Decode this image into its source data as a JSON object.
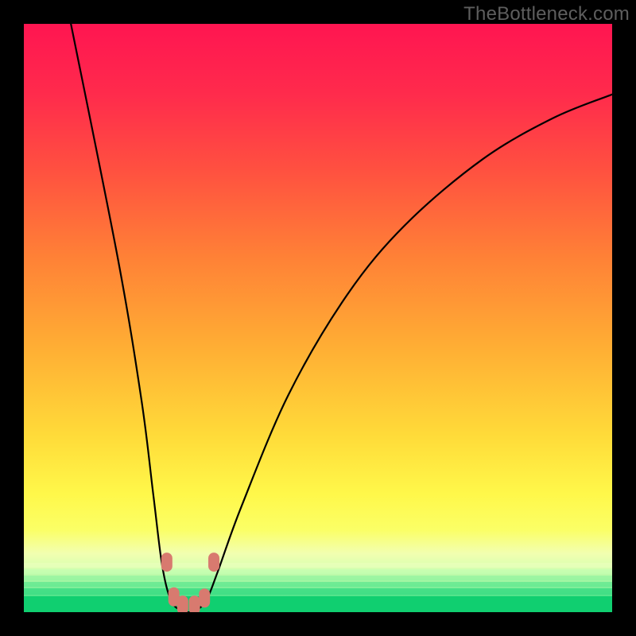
{
  "watermark": "TheBottleneck.com",
  "chart_data": {
    "type": "line",
    "title": "",
    "xlabel": "",
    "ylabel": "",
    "xlim": [
      0,
      100
    ],
    "ylim": [
      0,
      100
    ],
    "curves": [
      {
        "name": "v-curve",
        "points": [
          {
            "x": 8,
            "y": 100
          },
          {
            "x": 16,
            "y": 60
          },
          {
            "x": 20,
            "y": 36
          },
          {
            "x": 22,
            "y": 20
          },
          {
            "x": 23.5,
            "y": 8
          },
          {
            "x": 25,
            "y": 2
          },
          {
            "x": 27,
            "y": 0.2
          },
          {
            "x": 29,
            "y": 0.2
          },
          {
            "x": 31,
            "y": 2
          },
          {
            "x": 33,
            "y": 7
          },
          {
            "x": 37,
            "y": 18
          },
          {
            "x": 45,
            "y": 37
          },
          {
            "x": 55,
            "y": 54
          },
          {
            "x": 65,
            "y": 66
          },
          {
            "x": 78,
            "y": 77
          },
          {
            "x": 90,
            "y": 84
          },
          {
            "x": 100,
            "y": 88
          }
        ]
      }
    ],
    "markers": [
      {
        "x": 24.3,
        "y": 8.5
      },
      {
        "x": 25.5,
        "y": 2.6
      },
      {
        "x": 27.0,
        "y": 1.2
      },
      {
        "x": 29.0,
        "y": 1.2
      },
      {
        "x": 30.7,
        "y": 2.4
      },
      {
        "x": 32.3,
        "y": 8.5
      }
    ],
    "background_bands": [
      {
        "y0": 100,
        "y1": 80,
        "color": "#ff1a52"
      },
      {
        "y0": 80,
        "y1": 62,
        "color": "#ff4a3f"
      },
      {
        "y0": 62,
        "y1": 46,
        "color": "#ff7a34"
      },
      {
        "y0": 46,
        "y1": 30,
        "color": "#ffb333"
      },
      {
        "y0": 30,
        "y1": 18,
        "color": "#ffe43c"
      },
      {
        "y0": 18,
        "y1": 10,
        "color": "#fbff58"
      },
      {
        "y0": 10,
        "y1": 7,
        "color": "#edffb0"
      },
      {
        "y0": 7,
        "y1": 5,
        "color": "#c7ffb0"
      },
      {
        "y0": 5,
        "y1": 3.3,
        "color": "#8cf59e"
      },
      {
        "y0": 3.3,
        "y1": 2.0,
        "color": "#4ee48a"
      },
      {
        "y0": 2.0,
        "y1": 0.0,
        "color": "#10d072"
      }
    ]
  }
}
